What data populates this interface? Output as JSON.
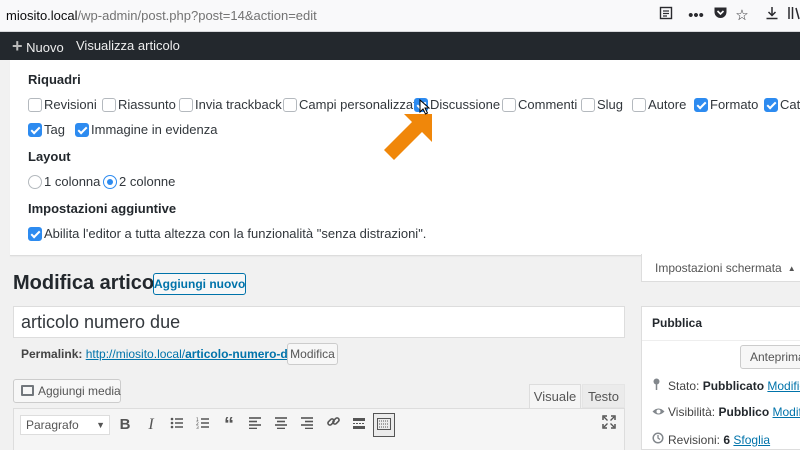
{
  "browser": {
    "url_domain": "miosito.local",
    "url_path": "/wp-admin/post.php?post=14&action=edit",
    "toolbar_icons": [
      "reader-view-icon",
      "more-icon",
      "pocket-icon",
      "bookmark-star-icon",
      "downloads-icon",
      "library-icon"
    ]
  },
  "admin_bar": {
    "new_label": "Nuovo",
    "view_label": "Visualizza articolo"
  },
  "screen_options": {
    "boxes_heading": "Riquadri",
    "boxes": [
      {
        "label": "Revisioni",
        "checked": false
      },
      {
        "label": "Riassunto",
        "checked": false
      },
      {
        "label": "Invia trackback",
        "checked": false
      },
      {
        "label": "Campi personalizzati",
        "checked": false
      },
      {
        "label": "Discussione",
        "checked": true
      },
      {
        "label": "Commenti",
        "checked": false
      },
      {
        "label": "Slug",
        "checked": false
      },
      {
        "label": "Autore",
        "checked": false
      },
      {
        "label": "Formato",
        "checked": true
      },
      {
        "label": "Categorie",
        "checked": true
      },
      {
        "label": "Tag",
        "checked": true
      },
      {
        "label": "Immagine in evidenza",
        "checked": true
      }
    ],
    "layout_heading": "Layout",
    "layout_options": [
      {
        "label": "1 colonna",
        "selected": false
      },
      {
        "label": "2 colonne",
        "selected": true
      }
    ],
    "extra_heading": "Impostazioni aggiuntive",
    "extra_option": {
      "label": "Abilita l'editor a tutta altezza con la funzionalità \"senza distrazioni\".",
      "checked": true
    },
    "tab_label": "Impostazioni schermata"
  },
  "editor": {
    "page_title": "Modifica articolo",
    "add_new_label": "Aggiungi nuovo",
    "post_title": "articolo numero due",
    "permalink_label": "Permalink:",
    "permalink_base": "http://miosito.local/",
    "permalink_slug": "articolo-numero-due",
    "permalink_trailing": "/",
    "permalink_edit_label": "Modifica",
    "add_media_label": "Aggiungi media",
    "tab_visual": "Visuale",
    "tab_text": "Testo",
    "format_select_value": "Paragrafo"
  },
  "publish_box": {
    "title": "Pubblica",
    "preview_label": "Anteprima",
    "status_label": "Stato:",
    "status_value": "Pubblicato",
    "status_edit": "Modifica",
    "visibility_label": "Visibilità:",
    "visibility_value": "Pubblico",
    "visibility_edit": "Modifica",
    "revisions_label": "Revisioni:",
    "revisions_value": "6",
    "revisions_link": "Sfoglia"
  },
  "colors": {
    "admin_bar": "#23282d",
    "checkbox_checked": "#2d8bf0",
    "link": "#0073aa",
    "annotation_arrow": "#f0870a"
  }
}
